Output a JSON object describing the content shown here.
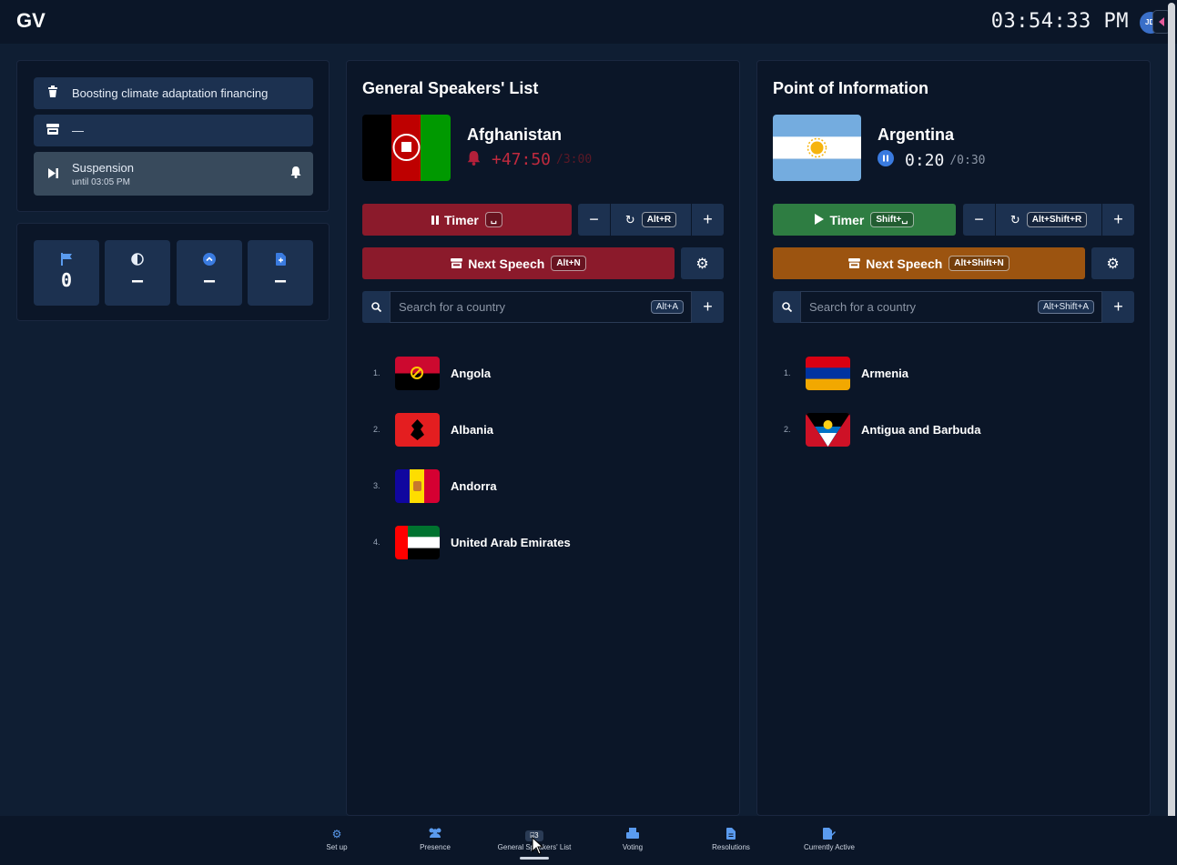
{
  "header": {
    "logo": "GV",
    "clock": "03:54:33 PM",
    "avatar": "JD"
  },
  "session": {
    "topic": "Boosting climate adaptation financing",
    "topic_icon": "trash-cup-icon",
    "agenda_value": "—",
    "agenda_icon": "podium-icon",
    "suspension_title": "Suspension",
    "suspension_until": "until 03:05 PM"
  },
  "stats": [
    {
      "icon": "flag-icon",
      "value": "0"
    },
    {
      "icon": "half-circle-icon",
      "value": "—"
    },
    {
      "icon": "chevron-up-circle-icon",
      "value": "—"
    },
    {
      "icon": "document-icon",
      "value": "—"
    }
  ],
  "gsl": {
    "title": "General Speakers' List",
    "current_country": "Afghanistan",
    "timer_elapsed": "+47:50",
    "timer_total": "/3:00",
    "timer_label": "Timer",
    "timer_key": "␣",
    "reset_key": "Alt+R",
    "next_label": "Next Speech",
    "next_key": "Alt+N",
    "search_placeholder": "Search for a country",
    "search_key": "Alt+A",
    "speakers": [
      {
        "num": "1.",
        "name": "Angola"
      },
      {
        "num": "2.",
        "name": "Albania"
      },
      {
        "num": "3.",
        "name": "Andorra"
      },
      {
        "num": "4.",
        "name": "United Arab Emirates"
      }
    ]
  },
  "poi": {
    "title": "Point of Information",
    "current_country": "Argentina",
    "timer_elapsed": "0:20",
    "timer_total": "/0:30",
    "timer_label": "Timer",
    "timer_key": "Shift+␣",
    "reset_key": "Alt+Shift+R",
    "next_label": "Next Speech",
    "next_key": "Alt+Shift+N",
    "search_placeholder": "Search for a country",
    "search_key": "Alt+Shift+A",
    "speakers": [
      {
        "num": "1.",
        "name": "Armenia"
      },
      {
        "num": "2.",
        "name": "Antigua and Barbuda"
      }
    ]
  },
  "nav": [
    {
      "label": "Set up",
      "icon": "gears-icon"
    },
    {
      "label": "Presence",
      "icon": "users-icon"
    },
    {
      "label": "General Speakers' List",
      "icon": "badge-3",
      "badge": "⌸3"
    },
    {
      "label": "Voting",
      "icon": "ballot-box-icon"
    },
    {
      "label": "Resolutions",
      "icon": "file-icon"
    },
    {
      "label": "Currently Active",
      "icon": "edit-icon"
    }
  ],
  "colors": {
    "background": "#0f1e33",
    "panel": "#0b1628",
    "control": "#1c3150",
    "accent_red": "#8b1a2b",
    "accent_green": "#2e7d42",
    "accent_orange": "#9c5410",
    "accent_blue": "#5a9bef"
  }
}
